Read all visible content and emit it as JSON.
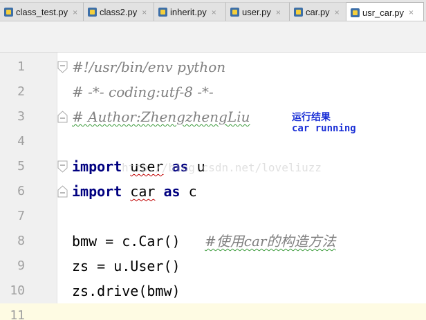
{
  "tabs": [
    {
      "label": "class_test.py",
      "active": false
    },
    {
      "label": "class2.py",
      "active": false
    },
    {
      "label": "inherit.py",
      "active": false
    },
    {
      "label": "user.py",
      "active": false
    },
    {
      "label": "car.py",
      "active": false
    },
    {
      "label": "usr_car.py",
      "active": true
    }
  ],
  "close_glyph": "×",
  "line_numbers": [
    "1",
    "2",
    "3",
    "4",
    "5",
    "6",
    "7",
    "8",
    "9",
    "10",
    "11"
  ],
  "code": {
    "l1": "#!/usr/bin/env python",
    "l2": "# -*- coding:utf-8 -*-",
    "l3": "# Author:ZhengzhengLiu",
    "l5_kw": "import",
    "l5_mod": "user",
    "l5_as": "as",
    "l5_alias": "u",
    "l6_kw": "import",
    "l6_mod": "car",
    "l6_as": "as",
    "l6_alias": "c",
    "l8_code": "bmw = c.Car()",
    "l8_comment": "#使用car的构造方法",
    "l9": "zs = u.User()",
    "l10": "zs.drive(bmw)"
  },
  "annotation": {
    "title": "运行结果",
    "output": "car running"
  },
  "watermark": "http://blog.csdn.net/loveliuzz",
  "colors": {
    "keyword": "#000080",
    "comment": "#808080",
    "annotation": "#1a2fd6",
    "current_line": "#fefbe3"
  }
}
